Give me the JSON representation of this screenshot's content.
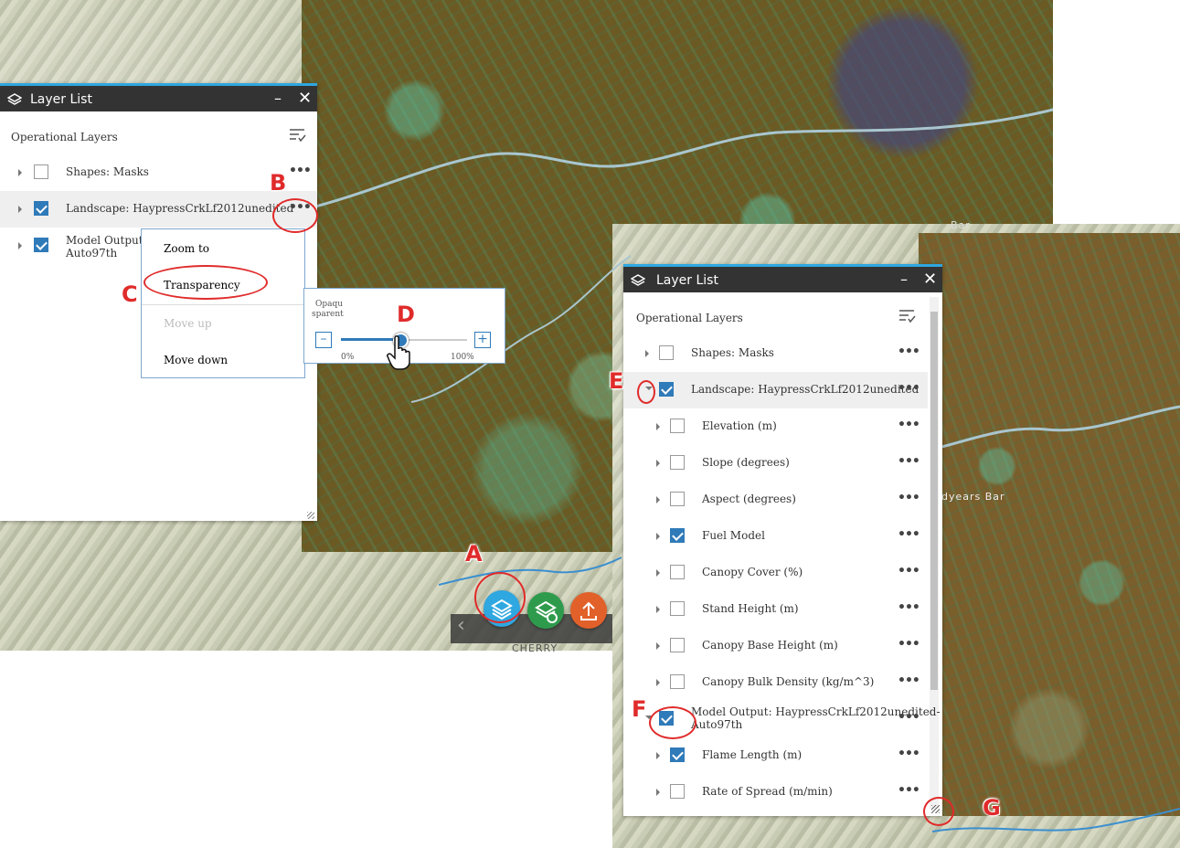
{
  "colors": {
    "accent": "#2fa7e0",
    "checkbox": "#2f7ab9",
    "annotation": "#e02b2b",
    "header": "#333333"
  },
  "map": {
    "labels": {
      "bottom": "CHERRY",
      "bar1": "Bar",
      "bar2": "dyears Bar"
    }
  },
  "panel1": {
    "title": "Layer List",
    "minimize": "–",
    "close": "✕",
    "section_title": "Operational Layers",
    "layers": [
      {
        "label": "Shapes: Masks",
        "checked": false
      },
      {
        "label": "Landscape: HaypressCrkLf2012unedited",
        "checked": true
      },
      {
        "label": "Model Output: H",
        "label2": "Auto97th",
        "checked": true
      }
    ],
    "menu": {
      "items": [
        "Zoom to",
        "Transparency",
        "Move up",
        "Move down"
      ]
    },
    "transparency": {
      "label_top": "Opaqu",
      "label_bottom": "sparent",
      "min_label": "0%",
      "max_label": "100%",
      "minus": "–",
      "plus": "+",
      "value": 0.47
    }
  },
  "panel2": {
    "title": "Layer List",
    "minimize": "–",
    "close": "✕",
    "section_title": "Operational Layers",
    "layers": [
      {
        "label": "Shapes: Masks",
        "checked": false,
        "level": 0
      },
      {
        "label": "Landscape: HaypressCrkLf2012unedited",
        "checked": true,
        "level": 0
      },
      {
        "label": "Elevation (m)",
        "checked": false,
        "level": 1
      },
      {
        "label": "Slope (degrees)",
        "checked": false,
        "level": 1
      },
      {
        "label": "Aspect (degrees)",
        "checked": false,
        "level": 1
      },
      {
        "label": "Fuel Model",
        "checked": true,
        "level": 1
      },
      {
        "label": "Canopy Cover (%)",
        "checked": false,
        "level": 1
      },
      {
        "label": "Stand Height (m)",
        "checked": false,
        "level": 1
      },
      {
        "label": "Canopy Base Height (m)",
        "checked": false,
        "level": 1
      },
      {
        "label": "Canopy Bulk Density (kg/m^3)",
        "checked": false,
        "level": 1
      },
      {
        "label": "Model Output: HaypressCrkLf2012unedited-",
        "label2": "Auto97th",
        "checked": true,
        "level": 0
      },
      {
        "label": "Flame Length (m)",
        "checked": true,
        "level": 1
      },
      {
        "label": "Rate of Spread (m/min)",
        "checked": false,
        "level": 1
      }
    ]
  },
  "toolbar": {
    "collapse": "‹",
    "buttons": [
      {
        "icon": "layers-icon"
      },
      {
        "icon": "add-layer-icon"
      },
      {
        "icon": "upload-icon"
      }
    ]
  },
  "annotations": {
    "a": "A",
    "b": "B",
    "c": "C",
    "d": "D",
    "e": "E",
    "f": "F",
    "g": "G"
  },
  "dots": "•••"
}
